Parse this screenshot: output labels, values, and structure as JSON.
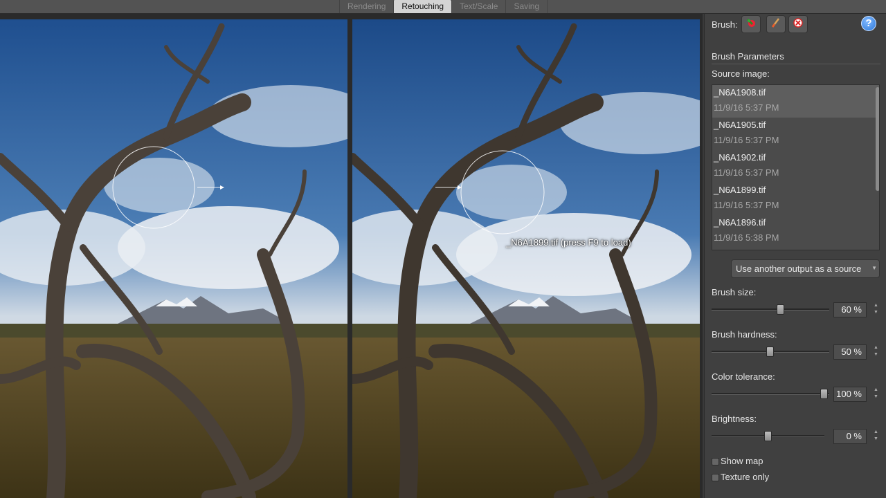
{
  "tabs": [
    "Rendering",
    "Retouching",
    "Text/Scale",
    "Saving"
  ],
  "active_tab": "Retouching",
  "overlay_label": "_N6A1899.tif (press F9 to load)",
  "panel": {
    "brush_label": "Brush:",
    "brush_tools": [
      "clone-brush-icon",
      "paint-brush-icon",
      "erase-brush-icon"
    ],
    "help": "?",
    "section_title": "Brush Parameters",
    "source_label": "Source image:",
    "sources": [
      {
        "name": "_N6A1908.tif",
        "date": "11/9/16 5:37 PM"
      },
      {
        "name": "_N6A1905.tif",
        "date": "11/9/16 5:37 PM"
      },
      {
        "name": "_N6A1902.tif",
        "date": "11/9/16 5:37 PM"
      },
      {
        "name": "_N6A1899.tif",
        "date": "11/9/16 5:37 PM"
      },
      {
        "name": "_N6A1896.tif",
        "date": "11/9/16 5:38 PM"
      }
    ],
    "selected_source": 0,
    "use_output_button": "Use another output as a source",
    "brush_size": {
      "label": "Brush size:",
      "display": "60 %",
      "value": 0.6
    },
    "brush_hardness": {
      "label": "Brush hardness:",
      "display": "50 %",
      "value": 0.5
    },
    "color_tolerance": {
      "label": "Color tolerance:",
      "display": "100 %",
      "value": 1.0
    },
    "brightness": {
      "label": "Brightness:",
      "display": "0 %",
      "value": 0.5
    },
    "show_map": {
      "label": "Show map",
      "checked": false
    },
    "texture_only": {
      "label": "Texture only",
      "checked": false
    }
  },
  "colors": {
    "panel_bg": "#404040",
    "tab_active": "#d4d4d4",
    "sky": "#2d5fa0"
  }
}
